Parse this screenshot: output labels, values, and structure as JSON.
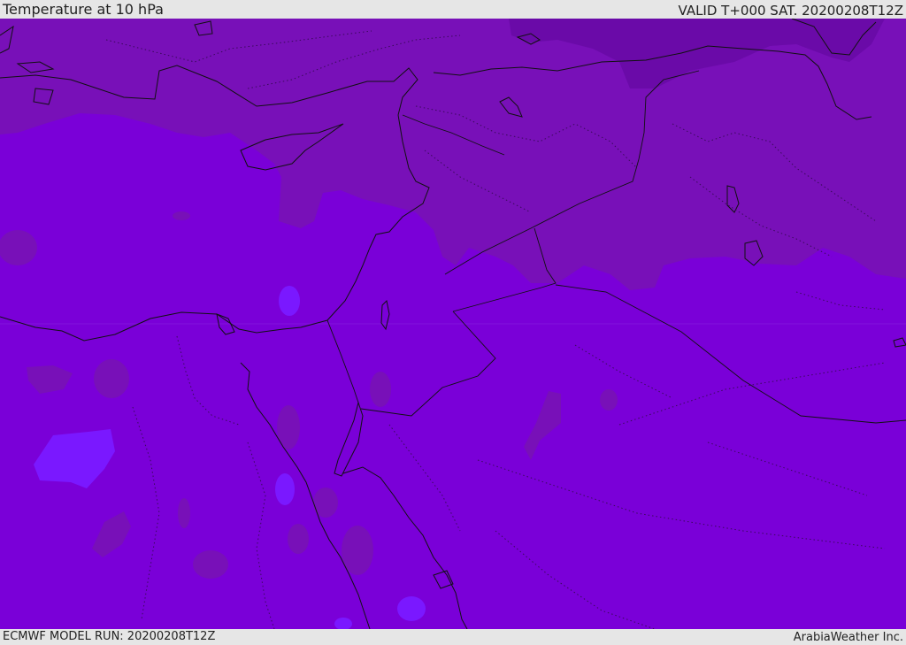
{
  "header": {
    "title": "Temperature at 10 hPa",
    "valid_time": "VALID T+000 SAT. 20200208T12Z"
  },
  "footer": {
    "model_run": "ECMWF MODEL RUN: 20200208T12Z",
    "credit": "ArabiaWeather Inc."
  },
  "map": {
    "variable": "temperature",
    "level": "10 hPa",
    "region": "Eastern Mediterranean / Middle East",
    "colors": {
      "base_fill": "#7a00d8",
      "warmer_fill": "#7810b8",
      "warmest_fill": "#6a0aa8",
      "cold_fill": "#7a18ff",
      "coast_line": "#111111",
      "border_dotted": "#3a0a5a"
    }
  }
}
